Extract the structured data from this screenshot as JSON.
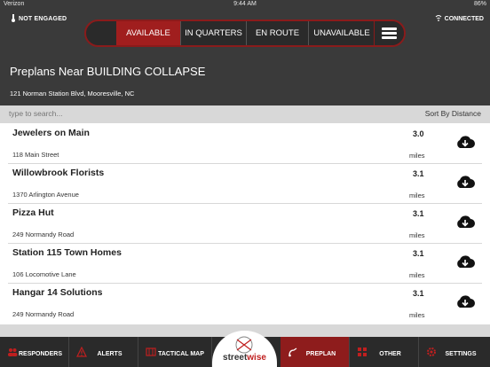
{
  "status_bar": {
    "carrier": "Verizon",
    "time": "9:44 AM",
    "battery": "86%"
  },
  "top_bar": {
    "engagement_status": "NOT ENGAGED",
    "connection_status": "CONNECTED",
    "status_buttons": [
      "AVAILABLE",
      "IN QUARTERS",
      "EN ROUTE",
      "UNAVAILABLE"
    ],
    "active_status": "AVAILABLE"
  },
  "header": {
    "title": "Preplans Near BUILDING COLLAPSE",
    "address": "121 Norman Station Blvd, Mooresville, NC"
  },
  "search": {
    "placeholder": "type to search...",
    "sort_label": "Sort By Distance"
  },
  "preplans": [
    {
      "name": "Jewelers on Main",
      "address": "118 Main Street",
      "distance": "3.0",
      "unit": "miles"
    },
    {
      "name": "Willowbrook Florists",
      "address": "1370 Arlington Avenue",
      "distance": "3.1",
      "unit": "miles"
    },
    {
      "name": "Pizza Hut",
      "address": "249 Normandy Road",
      "distance": "3.1",
      "unit": "miles"
    },
    {
      "name": "Station 115 Town Homes",
      "address": "106 Locomotive Lane",
      "distance": "3.1",
      "unit": "miles"
    },
    {
      "name": "Hangar 14 Solutions",
      "address": "249 Normandy Road",
      "distance": "3.1",
      "unit": "miles"
    }
  ],
  "bottom_nav": {
    "tabs": [
      "RESPONDERS",
      "ALERTS",
      "TACTICAL MAP",
      "PREPLAN",
      "OTHER",
      "SETTINGS"
    ],
    "active": "PREPLAN",
    "logo_text_a": "street",
    "logo_text_b": "wise"
  },
  "colors": {
    "accent": "#a01e1e",
    "bar": "#3a3a3a",
    "background": "#d8d8d8"
  }
}
